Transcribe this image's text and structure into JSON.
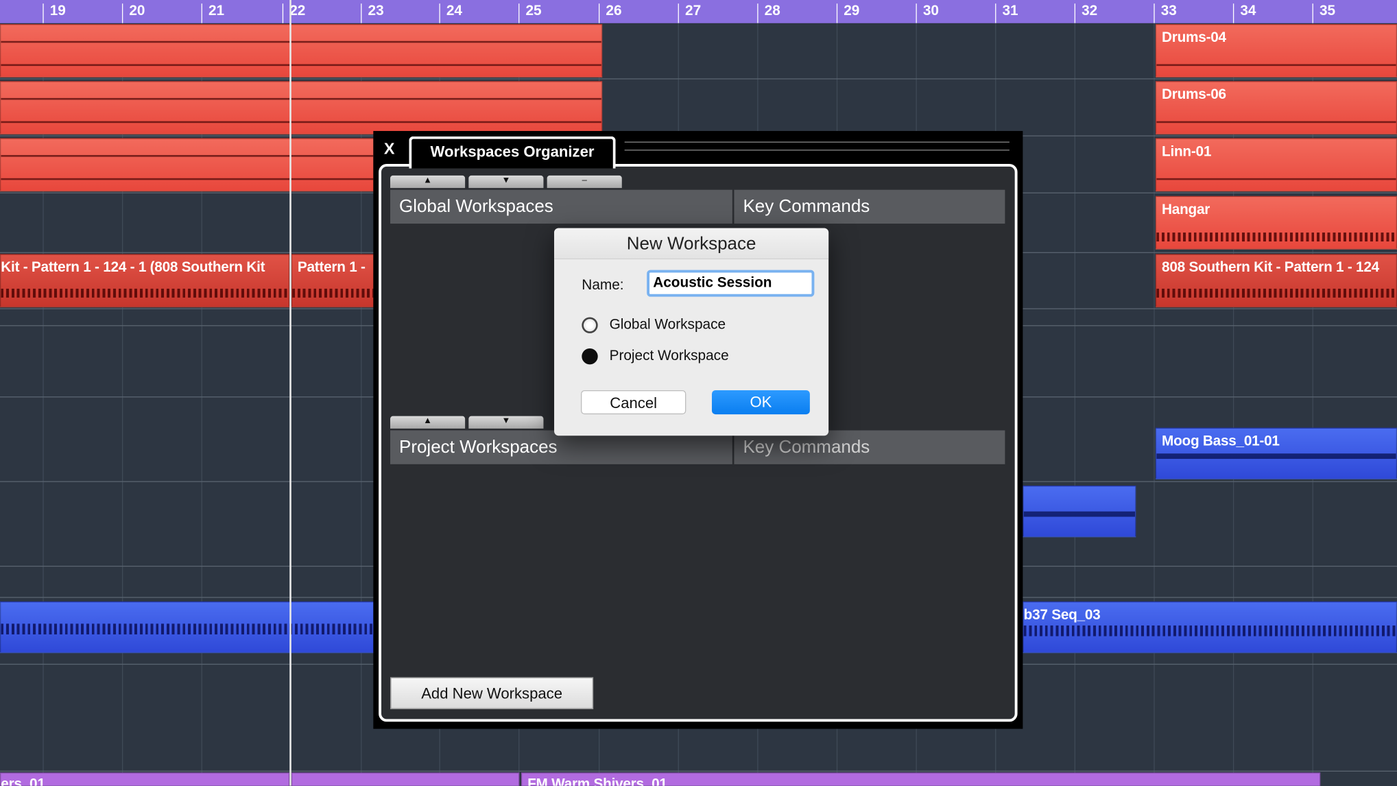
{
  "ruler": {
    "bars": [
      "19",
      "20",
      "21",
      "22",
      "23",
      "24",
      "25",
      "26",
      "27",
      "28",
      "29",
      "30",
      "31",
      "32",
      "33",
      "34",
      "35"
    ]
  },
  "tracks": {
    "drums04": "Drums-04",
    "drums06": "Drums-06",
    "linn01": "Linn-01",
    "hangar": "Hangar",
    "pattern_left": "Kit - Pattern 1 - 124 - 1 (808 Southern Kit",
    "pattern_mid": "Pattern 1 -",
    "pattern_right": "808 Southern Kit - Pattern 1 - 124",
    "moog": "Moog Bass_01-01",
    "seq": "b37 Seq_03",
    "bottom_left": "ers_01",
    "bottom_mid": "FM Warm Shivers_01"
  },
  "organizer": {
    "close_label": "X",
    "title": "Workspaces Organizer",
    "up_label": "▲",
    "down_label": "▼",
    "remove_label": "–",
    "global_header": "Global Workspaces",
    "key_commands_header": "Key Commands",
    "project_header": "Project Workspaces",
    "add_button": "Add New Workspace"
  },
  "dialog": {
    "title": "New Workspace",
    "name_label": "Name:",
    "name_value": "Acoustic Session",
    "option_global": "Global Workspace",
    "option_project": "Project Workspace",
    "selected_option": "project",
    "cancel": "Cancel",
    "ok": "OK"
  },
  "colors": {
    "ruler": "#8a6fe0",
    "audio_red": "#ee5a4d",
    "midi_blue": "#3a56e6",
    "purple": "#b26be0",
    "ok_blue": "#0a7ef0"
  }
}
